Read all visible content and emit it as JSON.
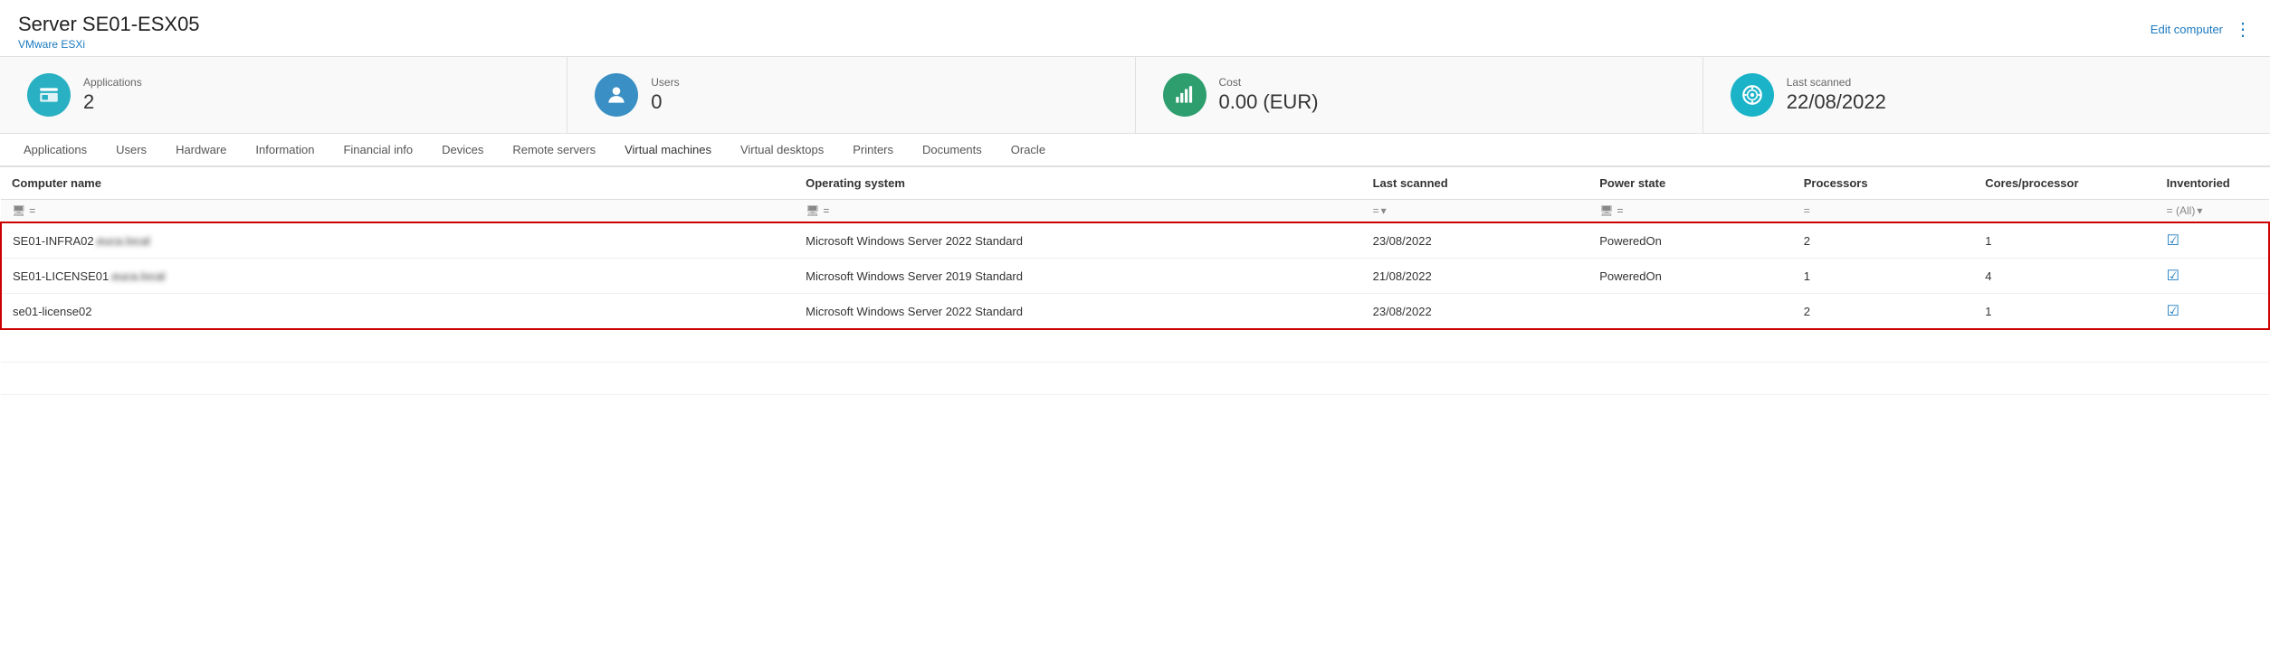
{
  "header": {
    "title": "Server SE01-ESX05",
    "subtitle": "VMware ESXi",
    "edit_label": "Edit computer",
    "more_icon": "⋮"
  },
  "summary_cards": [
    {
      "id": "applications",
      "label": "Applications",
      "value": "2",
      "icon_type": "teal",
      "icon_name": "applications-icon"
    },
    {
      "id": "users",
      "label": "Users",
      "value": "0",
      "icon_type": "blue",
      "icon_name": "users-icon"
    },
    {
      "id": "cost",
      "label": "Cost",
      "value": "0.00 (EUR)",
      "icon_type": "green",
      "icon_name": "cost-icon"
    },
    {
      "id": "last_scanned",
      "label": "Last scanned",
      "value": "22/08/2022",
      "icon_type": "cyan",
      "icon_name": "scan-icon"
    }
  ],
  "tabs": [
    {
      "id": "applications",
      "label": "Applications",
      "active": false
    },
    {
      "id": "users",
      "label": "Users",
      "active": false
    },
    {
      "id": "hardware",
      "label": "Hardware",
      "active": false
    },
    {
      "id": "information",
      "label": "Information",
      "active": false
    },
    {
      "id": "financial_info",
      "label": "Financial info",
      "active": false
    },
    {
      "id": "devices",
      "label": "Devices",
      "active": false
    },
    {
      "id": "remote_servers",
      "label": "Remote servers",
      "active": false
    },
    {
      "id": "virtual_machines",
      "label": "Virtual machines",
      "active": true
    },
    {
      "id": "virtual_desktops",
      "label": "Virtual desktops",
      "active": false
    },
    {
      "id": "printers",
      "label": "Printers",
      "active": false
    },
    {
      "id": "documents",
      "label": "Documents",
      "active": false
    },
    {
      "id": "oracle",
      "label": "Oracle",
      "active": false
    }
  ],
  "table": {
    "columns": [
      {
        "id": "computer_name",
        "label": "Computer name",
        "width": "35%"
      },
      {
        "id": "operating_system",
        "label": "Operating system",
        "width": "25%"
      },
      {
        "id": "last_scanned",
        "label": "Last scanned",
        "width": "10%"
      },
      {
        "id": "power_state",
        "label": "Power state",
        "width": "9%"
      },
      {
        "id": "processors",
        "label": "Processors",
        "width": "8%"
      },
      {
        "id": "cores_processor",
        "label": "Cores/processor",
        "width": "8%"
      },
      {
        "id": "inventoried",
        "label": "Inventoried",
        "width": "5%"
      }
    ],
    "filters": {
      "computer_name_placeholder": "=",
      "operating_system_placeholder": "=",
      "last_scanned_placeholder": "=",
      "power_state_placeholder": "=",
      "processors_placeholder": "=",
      "inventoried_placeholder": "= (All)"
    },
    "rows": [
      {
        "computer_name": "SE01-INFRA02",
        "computer_name_suffix": ".euca.local",
        "operating_system": "Microsoft Windows Server 2022 Standard",
        "last_scanned": "23/08/2022",
        "power_state": "PoweredOn",
        "processors": "2",
        "cores_processor": "1",
        "inventoried": true,
        "highlighted": true
      },
      {
        "computer_name": "SE01-LICENSE01",
        "computer_name_suffix": ".euca.local",
        "operating_system": "Microsoft Windows Server 2019 Standard",
        "last_scanned": "21/08/2022",
        "power_state": "PoweredOn",
        "processors": "1",
        "cores_processor": "4",
        "inventoried": true,
        "highlighted": true
      },
      {
        "computer_name": "se01-license02",
        "computer_name_suffix": "",
        "operating_system": "Microsoft Windows Server 2022 Standard",
        "last_scanned": "23/08/2022",
        "power_state": "",
        "processors": "2",
        "cores_processor": "1",
        "inventoried": true,
        "highlighted": true
      }
    ]
  }
}
